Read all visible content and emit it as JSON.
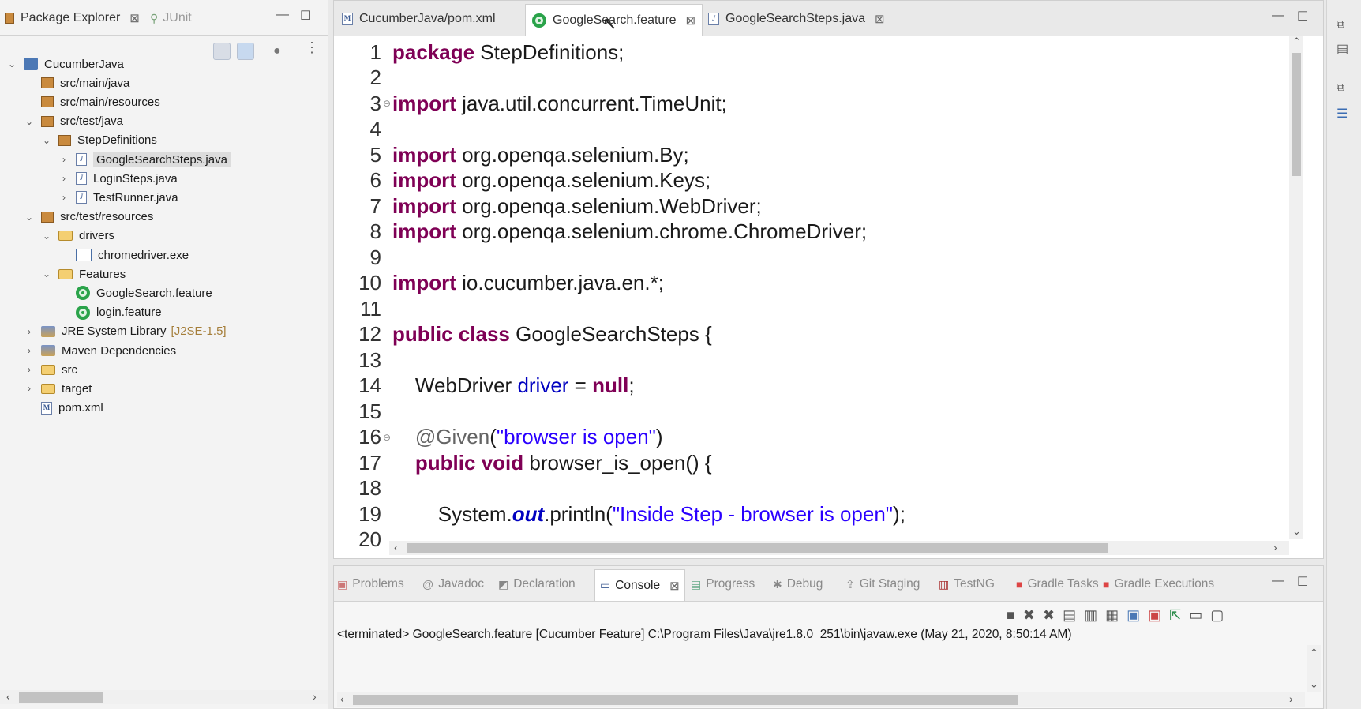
{
  "left_panel": {
    "tabs": [
      {
        "label": "Package Explorer",
        "close": "⊠"
      },
      {
        "label": "JUnit"
      }
    ],
    "tree": [
      {
        "label": "CucumberJava",
        "arrow": "v",
        "icon": "project-icon",
        "depth": 0
      },
      {
        "label": "src/main/java",
        "arrow": "",
        "icon": "package-folder-icon",
        "depth": 1
      },
      {
        "label": "src/main/resources",
        "arrow": "",
        "icon": "package-folder-icon",
        "depth": 1
      },
      {
        "label": "src/test/java",
        "arrow": "v",
        "icon": "package-folder-icon",
        "depth": 1
      },
      {
        "label": "StepDefinitions",
        "arrow": "v",
        "icon": "package-icon",
        "depth": 2
      },
      {
        "label": "GoogleSearchSteps.java",
        "arrow": ">",
        "icon": "java-file-icon",
        "depth": 3,
        "selected": true
      },
      {
        "label": "LoginSteps.java",
        "arrow": ">",
        "icon": "java-file-icon",
        "depth": 3
      },
      {
        "label": "TestRunner.java",
        "arrow": ">",
        "icon": "java-file-icon",
        "depth": 3
      },
      {
        "label": "src/test/resources",
        "arrow": "v",
        "icon": "package-folder-icon",
        "depth": 1
      },
      {
        "label": "drivers",
        "arrow": "v",
        "icon": "folder-icon",
        "depth": 2
      },
      {
        "label": "chromedriver.exe",
        "arrow": "",
        "icon": "exe-icon",
        "depth": 3
      },
      {
        "label": "Features",
        "arrow": "v",
        "icon": "folder-icon",
        "depth": 2
      },
      {
        "label": "GoogleSearch.feature",
        "arrow": "",
        "icon": "cucumber-icon",
        "depth": 3
      },
      {
        "label": "login.feature",
        "arrow": "",
        "icon": "cucumber-icon",
        "depth": 3
      },
      {
        "label": "JRE System Library",
        "deco": "[J2SE-1.5]",
        "arrow": ">",
        "icon": "library-icon",
        "depth": 1
      },
      {
        "label": "Maven Dependencies",
        "arrow": ">",
        "icon": "library-icon",
        "depth": 1
      },
      {
        "label": "src",
        "arrow": ">",
        "icon": "folder-icon",
        "depth": 1
      },
      {
        "label": "target",
        "arrow": ">",
        "icon": "folder-icon",
        "depth": 1
      },
      {
        "label": "pom.xml",
        "arrow": "",
        "icon": "xml-file-icon",
        "depth": 1
      }
    ]
  },
  "editor": {
    "tabs": [
      {
        "label": "CucumberJava/pom.xml",
        "icon": "xml-file-icon"
      },
      {
        "label": "GoogleSearch.feature",
        "icon": "cucumber-icon",
        "close": "⊠",
        "active": true
      },
      {
        "label": "GoogleSearchSteps.java",
        "icon": "java-file-icon",
        "close": "⊠"
      }
    ],
    "lines": [
      {
        "n": "1",
        "t": [
          [
            "kw",
            "package"
          ],
          [
            "plain",
            " StepDefinitions;"
          ]
        ]
      },
      {
        "n": "2",
        "t": []
      },
      {
        "n": "3",
        "fold": true,
        "t": [
          [
            "kw",
            "import"
          ],
          [
            "plain",
            " java.util.concurrent.TimeUnit;"
          ]
        ]
      },
      {
        "n": "4",
        "t": []
      },
      {
        "n": "5",
        "t": [
          [
            "kw",
            "import"
          ],
          [
            "plain",
            " org.openqa.selenium.By;"
          ]
        ]
      },
      {
        "n": "6",
        "t": [
          [
            "kw",
            "import"
          ],
          [
            "plain",
            " org.openqa.selenium.Keys;"
          ]
        ]
      },
      {
        "n": "7",
        "t": [
          [
            "kw",
            "import"
          ],
          [
            "plain",
            " org.openqa.selenium.WebDriver;"
          ]
        ]
      },
      {
        "n": "8",
        "t": [
          [
            "kw",
            "import"
          ],
          [
            "plain",
            " org.openqa.selenium.chrome.ChromeDriver;"
          ]
        ]
      },
      {
        "n": "9",
        "t": []
      },
      {
        "n": "10",
        "t": [
          [
            "kw",
            "import"
          ],
          [
            "plain",
            " io.cucumber.java.en.*;"
          ]
        ]
      },
      {
        "n": "11",
        "t": []
      },
      {
        "n": "12",
        "t": [
          [
            "kw",
            "public"
          ],
          [
            "plain",
            " "
          ],
          [
            "kw",
            "class"
          ],
          [
            "plain",
            " GoogleSearchSteps {"
          ]
        ]
      },
      {
        "n": "13",
        "t": []
      },
      {
        "n": "14",
        "t": [
          [
            "plain",
            "    WebDriver "
          ],
          [
            "fld",
            "driver"
          ],
          [
            "plain",
            " = "
          ],
          [
            "kw",
            "null"
          ],
          [
            "plain",
            ";"
          ]
        ]
      },
      {
        "n": "15",
        "t": []
      },
      {
        "n": "16",
        "fold": true,
        "t": [
          [
            "ann",
            "    @Given"
          ],
          [
            "plain",
            "("
          ],
          [
            "str",
            "\"browser is open\""
          ],
          [
            "plain",
            ")"
          ]
        ]
      },
      {
        "n": "17",
        "t": [
          [
            "plain",
            "    "
          ],
          [
            "kw",
            "public"
          ],
          [
            "plain",
            " "
          ],
          [
            "kw",
            "void"
          ],
          [
            "plain",
            " browser_is_open() {"
          ]
        ]
      },
      {
        "n": "18",
        "t": []
      },
      {
        "n": "19",
        "t": [
          [
            "plain",
            "        System."
          ],
          [
            "sfld",
            "out"
          ],
          [
            "plain",
            ".println("
          ],
          [
            "str",
            "\"Inside Step - browser is open\""
          ],
          [
            "plain",
            ");"
          ]
        ]
      },
      {
        "n": "20",
        "t": []
      }
    ]
  },
  "bottom": {
    "tabs": [
      {
        "label": "Problems",
        "icon": "problems-icon"
      },
      {
        "label": "Javadoc",
        "icon": "at-icon"
      },
      {
        "label": "Declaration",
        "icon": "declaration-icon"
      },
      {
        "label": "Console",
        "icon": "console-icon",
        "close": "⊠",
        "active": true
      },
      {
        "label": "Progress",
        "icon": "progress-icon"
      },
      {
        "label": "Debug",
        "icon": "debug-icon"
      },
      {
        "label": "Git Staging",
        "icon": "git-icon"
      },
      {
        "label": "TestNG",
        "icon": "testng-icon"
      },
      {
        "label": "Gradle Tasks",
        "icon": "gradle-icon"
      },
      {
        "label": "Gradle Executions",
        "icon": "gradle-icon"
      }
    ],
    "console_text": "<terminated> GoogleSearch.feature [Cucumber Feature] C:\\Program Files\\Java\\jre1.8.0_251\\bin\\javaw.exe (May 21, 2020, 8:50:14 AM)"
  },
  "colors": {
    "keyword": "#7f0055",
    "string": "#2a00ff",
    "field": "#0000c0",
    "selection": "#dcdcdc"
  }
}
